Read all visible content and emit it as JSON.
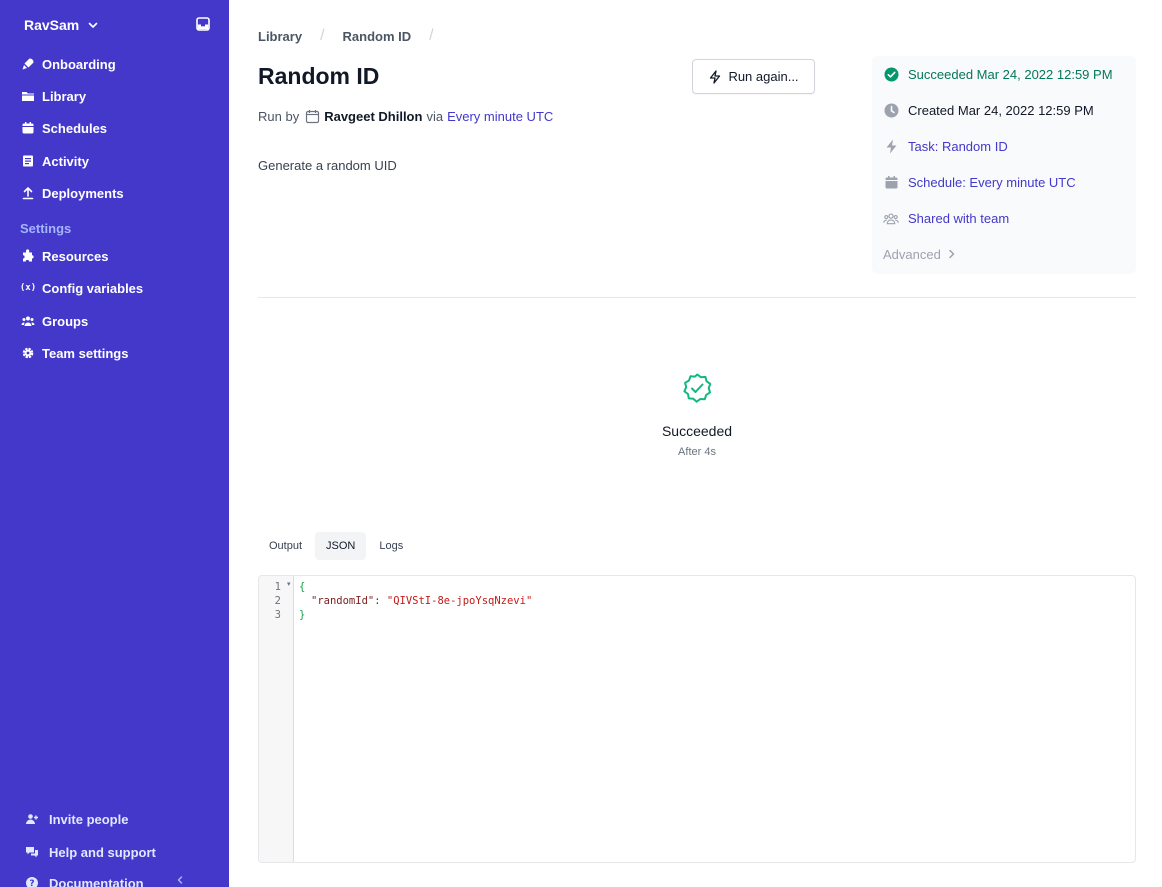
{
  "sidebar": {
    "workspace": "RavSam",
    "nav": [
      {
        "label": "Onboarding",
        "icon": "rocket-icon"
      },
      {
        "label": "Library",
        "icon": "folder-icon"
      },
      {
        "label": "Schedules",
        "icon": "calendar-icon"
      },
      {
        "label": "Activity",
        "icon": "activity-icon"
      },
      {
        "label": "Deployments",
        "icon": "upload-icon"
      }
    ],
    "settings_heading": "Settings",
    "settings_nav": [
      {
        "label": "Resources",
        "icon": "puzzle-icon"
      },
      {
        "label": "Config variables",
        "icon": "variable-icon",
        "glyph": "(x)"
      },
      {
        "label": "Groups",
        "icon": "users-icon"
      },
      {
        "label": "Team settings",
        "icon": "gear-icon"
      }
    ],
    "bottom": [
      {
        "label": "Invite people",
        "icon": "user-add-icon"
      },
      {
        "label": "Help and support",
        "icon": "chat-icon"
      },
      {
        "label": "Documentation",
        "icon": "question-icon"
      }
    ]
  },
  "breadcrumb": [
    "Library",
    "Random ID"
  ],
  "page": {
    "title": "Random ID",
    "run_again_label": "Run again...",
    "run_by_label": "Run by",
    "user": "Ravgeet Dhillon",
    "via": "via",
    "schedule": "Every minute UTC",
    "description": "Generate a random UID"
  },
  "details": {
    "status": "Succeeded Mar 24, 2022 12:59 PM",
    "created": "Created Mar 24, 2022 12:59 PM",
    "task": "Task: Random ID",
    "schedule": "Schedule: Every minute UTC",
    "shared": "Shared with team",
    "advanced": "Advanced"
  },
  "result": {
    "status": "Succeeded",
    "duration": "After 4s"
  },
  "tabs": [
    "Output",
    "JSON",
    "Logs"
  ],
  "active_tab": "JSON",
  "editor": {
    "line_numbers": [
      "1",
      "2",
      "3"
    ],
    "open_brace": "{",
    "key": "\"randomId\"",
    "colon": ": ",
    "value": "\"QIVStI-8e-jpoYsqNzevi\"",
    "close_brace": "}"
  },
  "colors": {
    "sidebar_bg": "#4338ca",
    "success": "#10b981",
    "link": "#4338ca"
  }
}
